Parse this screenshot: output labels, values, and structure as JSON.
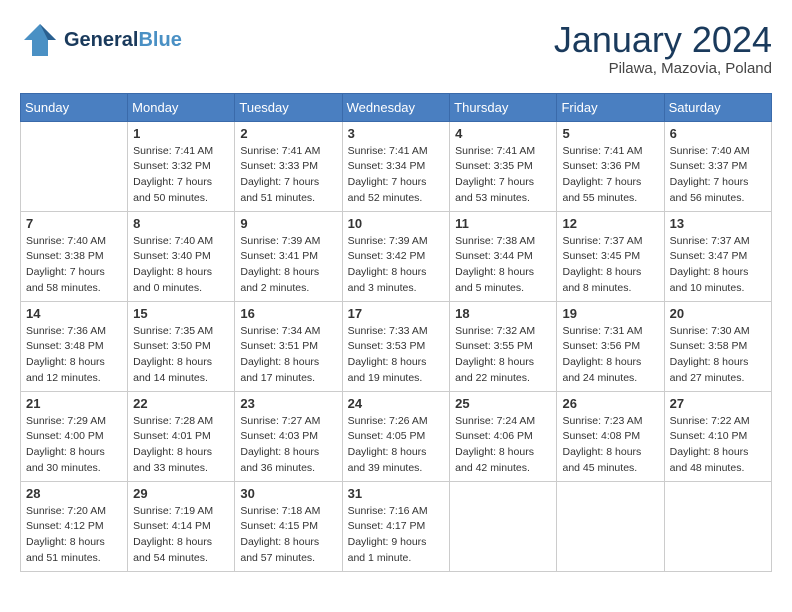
{
  "header": {
    "logo_general": "General",
    "logo_blue": "Blue",
    "month_title": "January 2024",
    "location": "Pilawa, Mazovia, Poland"
  },
  "days_of_week": [
    "Sunday",
    "Monday",
    "Tuesday",
    "Wednesday",
    "Thursday",
    "Friday",
    "Saturday"
  ],
  "weeks": [
    [
      {
        "day": "",
        "sunrise": "",
        "sunset": "",
        "daylight": ""
      },
      {
        "day": "1",
        "sunrise": "Sunrise: 7:41 AM",
        "sunset": "Sunset: 3:32 PM",
        "daylight": "Daylight: 7 hours and 50 minutes."
      },
      {
        "day": "2",
        "sunrise": "Sunrise: 7:41 AM",
        "sunset": "Sunset: 3:33 PM",
        "daylight": "Daylight: 7 hours and 51 minutes."
      },
      {
        "day": "3",
        "sunrise": "Sunrise: 7:41 AM",
        "sunset": "Sunset: 3:34 PM",
        "daylight": "Daylight: 7 hours and 52 minutes."
      },
      {
        "day": "4",
        "sunrise": "Sunrise: 7:41 AM",
        "sunset": "Sunset: 3:35 PM",
        "daylight": "Daylight: 7 hours and 53 minutes."
      },
      {
        "day": "5",
        "sunrise": "Sunrise: 7:41 AM",
        "sunset": "Sunset: 3:36 PM",
        "daylight": "Daylight: 7 hours and 55 minutes."
      },
      {
        "day": "6",
        "sunrise": "Sunrise: 7:40 AM",
        "sunset": "Sunset: 3:37 PM",
        "daylight": "Daylight: 7 hours and 56 minutes."
      }
    ],
    [
      {
        "day": "7",
        "sunrise": "Sunrise: 7:40 AM",
        "sunset": "Sunset: 3:38 PM",
        "daylight": "Daylight: 7 hours and 58 minutes."
      },
      {
        "day": "8",
        "sunrise": "Sunrise: 7:40 AM",
        "sunset": "Sunset: 3:40 PM",
        "daylight": "Daylight: 8 hours and 0 minutes."
      },
      {
        "day": "9",
        "sunrise": "Sunrise: 7:39 AM",
        "sunset": "Sunset: 3:41 PM",
        "daylight": "Daylight: 8 hours and 2 minutes."
      },
      {
        "day": "10",
        "sunrise": "Sunrise: 7:39 AM",
        "sunset": "Sunset: 3:42 PM",
        "daylight": "Daylight: 8 hours and 3 minutes."
      },
      {
        "day": "11",
        "sunrise": "Sunrise: 7:38 AM",
        "sunset": "Sunset: 3:44 PM",
        "daylight": "Daylight: 8 hours and 5 minutes."
      },
      {
        "day": "12",
        "sunrise": "Sunrise: 7:37 AM",
        "sunset": "Sunset: 3:45 PM",
        "daylight": "Daylight: 8 hours and 8 minutes."
      },
      {
        "day": "13",
        "sunrise": "Sunrise: 7:37 AM",
        "sunset": "Sunset: 3:47 PM",
        "daylight": "Daylight: 8 hours and 10 minutes."
      }
    ],
    [
      {
        "day": "14",
        "sunrise": "Sunrise: 7:36 AM",
        "sunset": "Sunset: 3:48 PM",
        "daylight": "Daylight: 8 hours and 12 minutes."
      },
      {
        "day": "15",
        "sunrise": "Sunrise: 7:35 AM",
        "sunset": "Sunset: 3:50 PM",
        "daylight": "Daylight: 8 hours and 14 minutes."
      },
      {
        "day": "16",
        "sunrise": "Sunrise: 7:34 AM",
        "sunset": "Sunset: 3:51 PM",
        "daylight": "Daylight: 8 hours and 17 minutes."
      },
      {
        "day": "17",
        "sunrise": "Sunrise: 7:33 AM",
        "sunset": "Sunset: 3:53 PM",
        "daylight": "Daylight: 8 hours and 19 minutes."
      },
      {
        "day": "18",
        "sunrise": "Sunrise: 7:32 AM",
        "sunset": "Sunset: 3:55 PM",
        "daylight": "Daylight: 8 hours and 22 minutes."
      },
      {
        "day": "19",
        "sunrise": "Sunrise: 7:31 AM",
        "sunset": "Sunset: 3:56 PM",
        "daylight": "Daylight: 8 hours and 24 minutes."
      },
      {
        "day": "20",
        "sunrise": "Sunrise: 7:30 AM",
        "sunset": "Sunset: 3:58 PM",
        "daylight": "Daylight: 8 hours and 27 minutes."
      }
    ],
    [
      {
        "day": "21",
        "sunrise": "Sunrise: 7:29 AM",
        "sunset": "Sunset: 4:00 PM",
        "daylight": "Daylight: 8 hours and 30 minutes."
      },
      {
        "day": "22",
        "sunrise": "Sunrise: 7:28 AM",
        "sunset": "Sunset: 4:01 PM",
        "daylight": "Daylight: 8 hours and 33 minutes."
      },
      {
        "day": "23",
        "sunrise": "Sunrise: 7:27 AM",
        "sunset": "Sunset: 4:03 PM",
        "daylight": "Daylight: 8 hours and 36 minutes."
      },
      {
        "day": "24",
        "sunrise": "Sunrise: 7:26 AM",
        "sunset": "Sunset: 4:05 PM",
        "daylight": "Daylight: 8 hours and 39 minutes."
      },
      {
        "day": "25",
        "sunrise": "Sunrise: 7:24 AM",
        "sunset": "Sunset: 4:06 PM",
        "daylight": "Daylight: 8 hours and 42 minutes."
      },
      {
        "day": "26",
        "sunrise": "Sunrise: 7:23 AM",
        "sunset": "Sunset: 4:08 PM",
        "daylight": "Daylight: 8 hours and 45 minutes."
      },
      {
        "day": "27",
        "sunrise": "Sunrise: 7:22 AM",
        "sunset": "Sunset: 4:10 PM",
        "daylight": "Daylight: 8 hours and 48 minutes."
      }
    ],
    [
      {
        "day": "28",
        "sunrise": "Sunrise: 7:20 AM",
        "sunset": "Sunset: 4:12 PM",
        "daylight": "Daylight: 8 hours and 51 minutes."
      },
      {
        "day": "29",
        "sunrise": "Sunrise: 7:19 AM",
        "sunset": "Sunset: 4:14 PM",
        "daylight": "Daylight: 8 hours and 54 minutes."
      },
      {
        "day": "30",
        "sunrise": "Sunrise: 7:18 AM",
        "sunset": "Sunset: 4:15 PM",
        "daylight": "Daylight: 8 hours and 57 minutes."
      },
      {
        "day": "31",
        "sunrise": "Sunrise: 7:16 AM",
        "sunset": "Sunset: 4:17 PM",
        "daylight": "Daylight: 9 hours and 1 minute."
      },
      {
        "day": "",
        "sunrise": "",
        "sunset": "",
        "daylight": ""
      },
      {
        "day": "",
        "sunrise": "",
        "sunset": "",
        "daylight": ""
      },
      {
        "day": "",
        "sunrise": "",
        "sunset": "",
        "daylight": ""
      }
    ]
  ]
}
